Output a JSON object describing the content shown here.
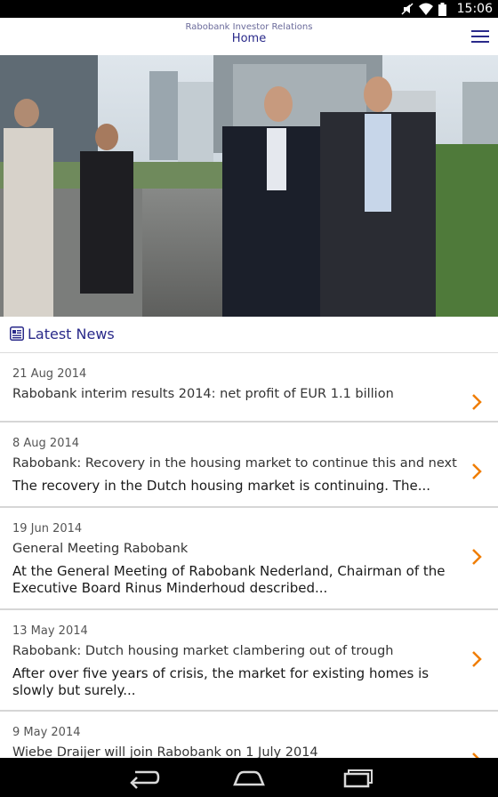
{
  "status_bar": {
    "time": "15:06"
  },
  "app_bar": {
    "subtitle": "Rabobank Investor Relations",
    "title": "Home"
  },
  "section": {
    "title": "Latest News"
  },
  "news": [
    {
      "date": "21 Aug 2014",
      "headline": "Rabobank interim results 2014: net profit of EUR 1.1 billion",
      "summary": ""
    },
    {
      "date": "8 Aug 2014",
      "headline": "Rabobank: Recovery in the housing market to continue this and next year",
      "summary": "The recovery in the Dutch housing market is continuing. The..."
    },
    {
      "date": "19 Jun 2014",
      "headline": "General Meeting Rabobank",
      "summary": "At the General Meeting of Rabobank Nederland, Chairman of the Executive Board Rinus Minderhoud described..."
    },
    {
      "date": "13 May 2014",
      "headline": "Rabobank: Dutch housing market clambering out of trough",
      "summary": "After over five years of crisis, the market for existing homes is slowly but surely..."
    },
    {
      "date": "9 May 2014",
      "headline": "Wiebe Draijer will join Rabobank on 1 July 2014",
      "summary": ""
    }
  ],
  "colors": {
    "accent": "#f07d00",
    "brand": "#2a2a8a"
  }
}
